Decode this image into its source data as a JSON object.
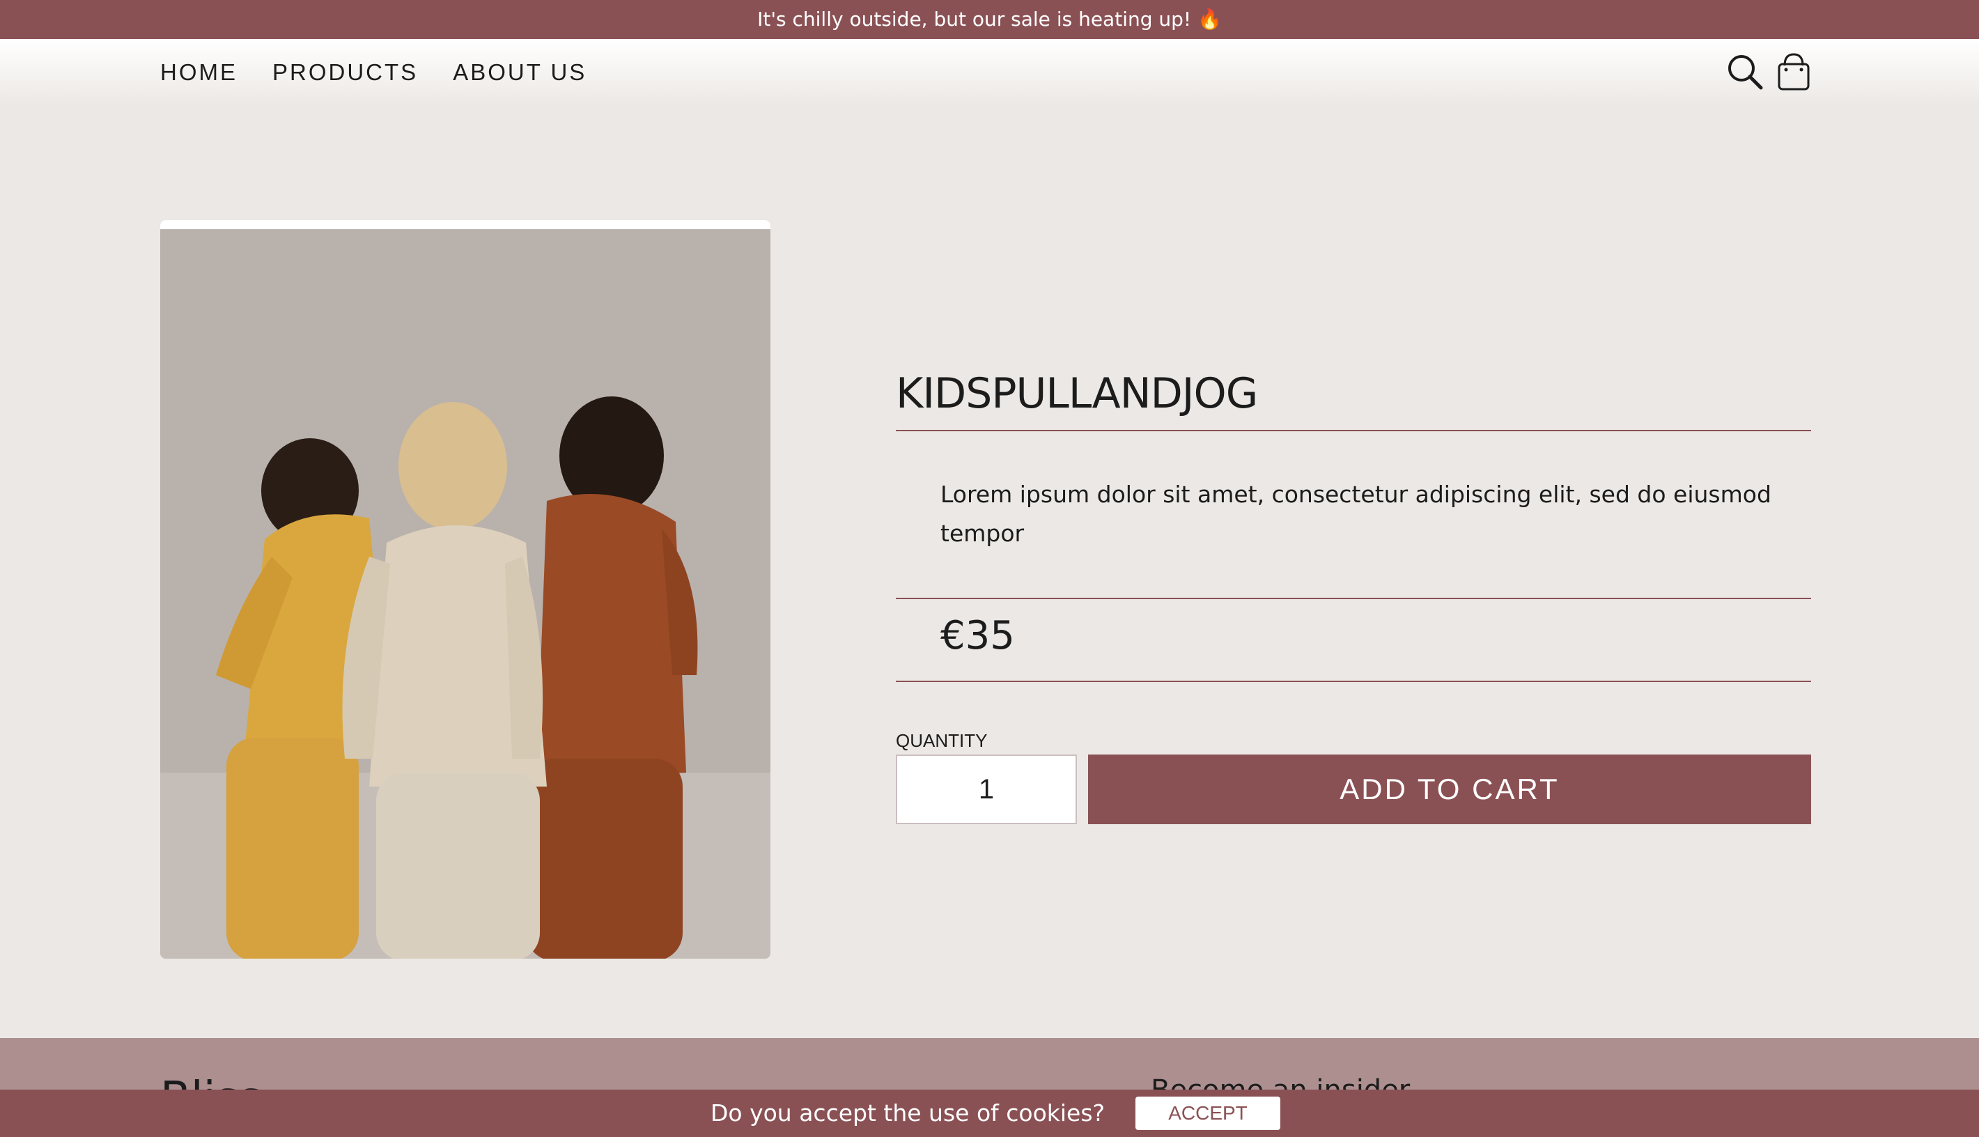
{
  "announcement": {
    "text": "It's chilly outside, but our sale is heating up!",
    "emoji": "🔥"
  },
  "nav": {
    "items": [
      {
        "label": "HOME"
      },
      {
        "label": "PRODUCTS"
      },
      {
        "label": "ABOUT US"
      }
    ]
  },
  "header_icons": [
    "search-icon",
    "shopping-bag-icon"
  ],
  "product": {
    "title": "KIDSPULLANDJOG",
    "description": "Lorem ipsum dolor sit amet, consectetur adipiscing elit, sed do eiusmod tempor",
    "price": "€35",
    "quantity_label": "QUANTITY",
    "quantity_value": "1",
    "add_to_cart_label": "ADD TO CART"
  },
  "footer": {
    "brand": "Bliss",
    "insider_heading": "Become an insider"
  },
  "cookie": {
    "text": "Do you accept the use of cookies?",
    "accept_label": "ACCEPT"
  },
  "colors": {
    "accent": "#8a5155",
    "background": "#ece8e5",
    "footer": "#ad8f90"
  }
}
